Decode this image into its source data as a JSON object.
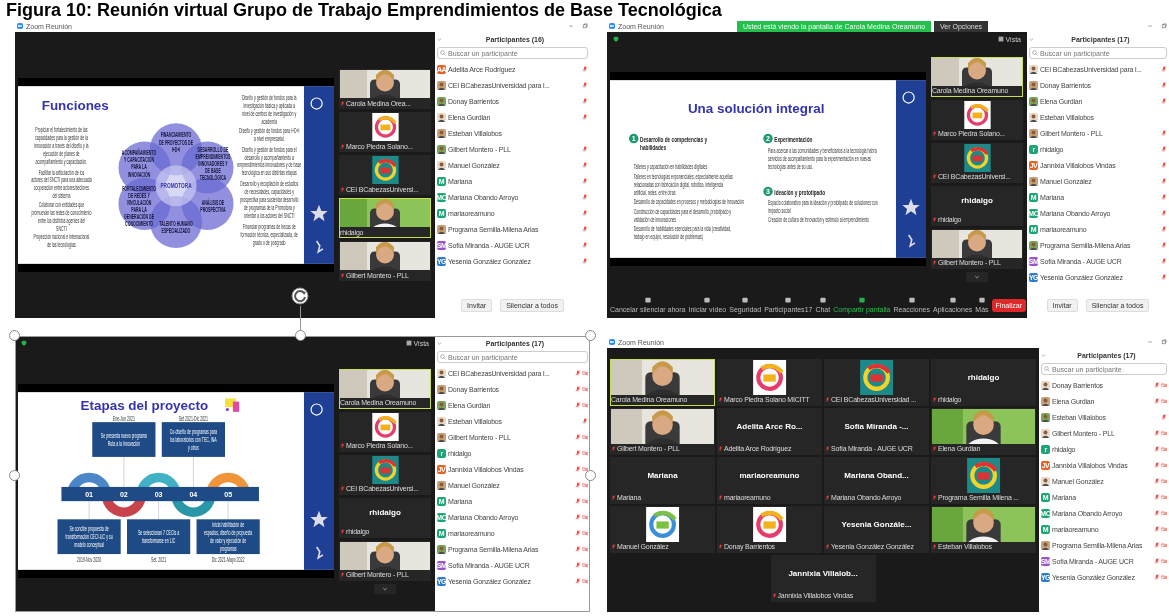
{
  "caption": "Figura 10: Reunión virtual Grupo de Trabajo Emprendimientos de Base Tecnológica",
  "windows": [
    {
      "title": "Zoom Reunión",
      "selected": false,
      "slide": {
        "kind": "flower",
        "title": "Funciones",
        "center": "PROMOTORA",
        "petals": [
          "FINANCIAMIENTO DE PROYECTOS DE I+D+i",
          "ACOMPAÑAMIENTO Y CAPACITACIÓN PARA LA INNOVACIÓN",
          "DESARROLLO DE EMPRENDIMIENTOS INNOVADORES Y DE BASE TECNOLÓGICA",
          "FORTALECIMIENTO DE REDES Y VINCULACIÓN PARA LA GENERACIÓN DE CONOCIMIENTO",
          "ANÁLISIS DE PROSPECTIVA",
          "TALENTO HUMANO ESPECIALIZADO"
        ],
        "notes": [
          {
            "bullets": [
              "Diseño y gestión de fondos para la investigación básica y aplicada a nivel de centros de investigación y academia",
              "Diseño y gestión de fondos para I+D+i a nivel empresarial."
            ]
          },
          {
            "bullets": [
              "Propiciar el fortalecimiento de las capacidades para la gestión de la innovación a través del diseño y la ejecución de planes de acompañamiento y capacitación."
            ]
          },
          {
            "bullets": [
              "Diseño y gestión de fondos para el desarrollo y acompañamiento a emprendimientos innovadores y de base tecnológica en sus distintas etapas"
            ]
          },
          {
            "bullets": [
              "Facilitar la articulación de los actores del SNCTI para una adecuada cooperación entre actores/sectores del sistema",
              "Colaborar con entidades que promuevan las redes de conocimiento entre los distintos agentes del SNCTI",
              "Proyección nacional e internacional de las tecnologías"
            ]
          },
          {
            "bullets": [
              "Desarrollo y recopilación de estudios de necesidades, capacidades y prospectiva para sustentar desarrollo de programas de la Promotora y orientar a los actores del SNCTI"
            ]
          },
          {
            "bullets": [
              "Financiar programas de becas de formación técnica, especializada, de grado o de posgrado"
            ]
          }
        ]
      },
      "thumbnails": [
        {
          "kind": "video",
          "caption": "Carola Medina Orea...",
          "muted": true,
          "selected": false
        },
        {
          "caption": "Marco Piedra Solano...",
          "muted": true,
          "selected": false
        },
        {
          "caption": "CEI BCabezasUniversi...",
          "muted": true,
          "selected": false
        },
        {
          "kind": "video",
          "caption": "rhidalgo",
          "muted": false,
          "selected": true
        },
        {
          "kind": "video",
          "caption": "Gilbert Montero - PLL",
          "muted": true,
          "selected": false
        }
      ],
      "participants": {
        "title": "Participantes (16)",
        "placeholder": "Buscar un participante",
        "buttons": [
          "Invitar",
          "Silenciar a todos"
        ],
        "items": [
          {
            "name": "Adelita Arce Rodríguez",
            "kind": "initials",
            "initials": "AA",
            "color": "#e8621d",
            "muted": true,
            "video_off": false
          },
          {
            "name": "CEI BCabezasUniversidad para l...",
            "muted": true,
            "video_off": false
          },
          {
            "name": "Donay Barrientos",
            "muted": true,
            "video_off": false
          },
          {
            "name": "Elena Gurdian",
            "muted": true,
            "video_off": false
          },
          {
            "name": "Esteban Villalobos",
            "muted": false,
            "video_off": false
          },
          {
            "name": "Gilbert Montero - PLL",
            "muted": true,
            "video_off": false
          },
          {
            "name": "Manuel González",
            "muted": true,
            "video_off": false
          },
          {
            "name": "Mariana",
            "kind": "initials",
            "initials": "M",
            "color": "#1ea672",
            "muted": true,
            "video_off": false
          },
          {
            "name": "Mariana Obando Arroyo",
            "kind": "initials",
            "initials": "MO",
            "color": "#1ea672",
            "muted": true,
            "video_off": false
          },
          {
            "name": "mariaoreamuno",
            "kind": "initials",
            "initials": "M",
            "color": "#1ea672",
            "muted": true,
            "video_off": false
          },
          {
            "name": "Programa Semilla-Milena Arias",
            "muted": true,
            "video_off": false
          },
          {
            "name": "Sofía Miranda - AUGE UCR",
            "kind": "initials",
            "initials": "SM",
            "color": "#9b4fd1",
            "muted": true,
            "video_off": false
          },
          {
            "name": "Yesenia González González",
            "kind": "initials",
            "initials": "YG",
            "color": "#2b7bd0",
            "muted": true,
            "video_off": false
          }
        ]
      }
    },
    {
      "title": "Zoom Reunión",
      "selected": false,
      "encrypted": true,
      "view_label": "Vista",
      "strip_more": true,
      "share_banner": {
        "text": "Usted está viendo la pantalla de Carola Medina Oreamuno",
        "options": "Ver Opciones"
      },
      "slide": {
        "kind": "sections",
        "title": "Una solución integral",
        "sections": [
          {
            "number": "1",
            "heading": "Desarrollo de competencias y habilidades",
            "bullets": [
              "Talleres y capacitación en habilidades digitales",
              "Talleres en tecnologías exponenciales, especialmente aquellas relacionadas con fabricación digital, robótica, inteligencia artificial, redes, entre otras",
              "Desarrollo de capacidades en procesos y metodologías de innovación",
              "Construcción de capacidades para el desarrollo, prototipado y validación de innovaciones",
              "Desarrollo de habilidades esenciales para la vida (creatividad, trabajo en equipo, resolución de problemas)"
            ]
          },
          {
            "number": "2",
            "heading": "Experimentación",
            "bullets": [
              "Para acercar a las comunidades y beneficiarios a la tecnología habrá servicios de acompañamiento para la experimentación en nuevas tecnologías antes de su uso."
            ]
          },
          {
            "number": "3",
            "heading": "Ideación y prototipado",
            "bullets": [
              "Espacio colaborativo para la ideación y prototipado de soluciones con impacto social",
              "Creación de cultura de innovación y estímulo al emprendimiento"
            ]
          }
        ]
      },
      "thumbnails": [
        {
          "kind": "video",
          "caption": "Carola Medina Oreamuno",
          "muted": false,
          "selected": true
        },
        {
          "caption": "Marco Piedra Solano...",
          "muted": true,
          "selected": false
        },
        {
          "caption": "CEI BCabezasUniversi...",
          "muted": true,
          "selected": false
        },
        {
          "kind": "name",
          "label": "rhidalgo",
          "caption": "rhidalgo",
          "muted": true,
          "selected": false
        },
        {
          "kind": "video",
          "caption": "Gilbert Montero - PLL",
          "muted": true,
          "selected": false
        }
      ],
      "toolbar": [
        {
          "label": "Cancelar silenciar ahora",
          "highlighted": false
        },
        {
          "label": "Iniciar vídeo",
          "highlighted": false
        },
        {
          "label": "Seguridad",
          "highlighted": false
        },
        {
          "label": "Participantes",
          "badge": "17",
          "highlighted": false
        },
        {
          "label": "Chat",
          "highlighted": false
        },
        {
          "label": "Compartir pantalla",
          "highlighted": true
        },
        {
          "label": "Reacciones",
          "highlighted": false
        },
        {
          "label": "Aplicaciones",
          "highlighted": false
        },
        {
          "label": "Más",
          "highlighted": false
        }
      ],
      "end_button": "Finalizar",
      "participants": {
        "title": "Participantes (17)",
        "placeholder": "Buscar un participante",
        "buttons": [
          "Invitar",
          "Silenciar a todos"
        ],
        "items": [
          {
            "name": "CEI BCabezasUniversidad para l...",
            "muted": true,
            "video_off": false
          },
          {
            "name": "Donay Barrientos",
            "muted": true,
            "video_off": false
          },
          {
            "name": "Elena Gurdian",
            "muted": true,
            "video_off": false
          },
          {
            "name": "Esteban Villalobos",
            "muted": false,
            "video_off": false
          },
          {
            "name": "Gilbert Montero - PLL",
            "muted": true,
            "video_off": false
          },
          {
            "name": "rhidalgo",
            "kind": "initials",
            "initials": "r",
            "color": "#1ea672",
            "muted": true,
            "video_off": false
          },
          {
            "name": "Jannixia Villalobos Vindas",
            "kind": "initials",
            "initials": "JV",
            "color": "#e8621d",
            "muted": true,
            "video_off": false
          },
          {
            "name": "Manuel González",
            "muted": true,
            "video_off": false
          },
          {
            "name": "Mariana",
            "kind": "initials",
            "initials": "M",
            "color": "#1ea672",
            "muted": true,
            "video_off": false
          },
          {
            "name": "Mariana Obando Arroyo",
            "kind": "initials",
            "initials": "MO",
            "color": "#1ea672",
            "muted": true,
            "video_off": false
          },
          {
            "name": "mariaoreamuno",
            "kind": "initials",
            "initials": "M",
            "color": "#1ea672",
            "muted": true,
            "video_off": false
          },
          {
            "name": "Programa Semilla-Milena Arias",
            "muted": true,
            "video_off": false
          },
          {
            "name": "Sofía Miranda - AUGE UCR",
            "kind": "initials",
            "initials": "SM",
            "color": "#9b4fd1",
            "muted": true,
            "video_off": false
          },
          {
            "name": "Yesenia González González",
            "kind": "initials",
            "initials": "YG",
            "color": "#2b7bd0",
            "muted": true,
            "video_off": false
          }
        ]
      }
    },
    {
      "selected": true,
      "encrypted": true,
      "view_label": "Vista",
      "strip_more": true,
      "slide": {
        "kind": "road",
        "title": "Etapas del proyecto",
        "stages": [
          {
            "number": "01",
            "date": "2019-Nov 2020",
            "text": "Se concibe propuesta de transformación CECI-LIC y su modelo conceptual",
            "color": "#4a86c8"
          },
          {
            "number": "02",
            "date": "Ene-Jun 2021",
            "text": "Se presenta nuevo programa Ruta a la Innovación",
            "color": "#c9444a"
          },
          {
            "number": "03",
            "date": "Set. 2021",
            "text": "Se seleccionan 7 CECIs a transformarse en LIC",
            "color": "#41b2c6"
          },
          {
            "number": "04",
            "date": "Set 2021-Dic 2021",
            "text": "Co-diseño de programas para los laboratorios con TEC, INA y otros",
            "color": "#2a97a8"
          },
          {
            "number": "05",
            "date": "Dic 2021-Mayo 2022",
            "text": "Inicia habilitación de espacios, diseño de propuesta de valor y ejecución de programas",
            "color": "#f0953a"
          }
        ]
      },
      "thumbnails": [
        {
          "kind": "video",
          "caption": "Carola Medina Oreamuno",
          "muted": false,
          "selected": true
        },
        {
          "caption": "Marco Piedra Solano...",
          "muted": true,
          "selected": false
        },
        {
          "caption": "CEI BCabezasUniversi...",
          "muted": true,
          "selected": false
        },
        {
          "kind": "name",
          "label": "rhidalgo",
          "caption": "rhidalgo",
          "muted": true,
          "selected": false
        },
        {
          "kind": "video",
          "caption": "Gilbert Montero - PLL",
          "muted": true,
          "selected": false
        }
      ],
      "participants": {
        "title": "Participantes (17)",
        "placeholder": "Buscar un participante",
        "items": [
          {
            "name": "CEI BCabezasUniversidad para l...",
            "muted": true,
            "video_off": true
          },
          {
            "name": "Donay Barrientos",
            "muted": true,
            "video_off": true
          },
          {
            "name": "Elena Gurdian",
            "muted": true,
            "video_off": true
          },
          {
            "name": "Esteban Villalobos",
            "muted": true,
            "video_off": false
          },
          {
            "name": "Gilbert Montero - PLL",
            "muted": true,
            "video_off": true
          },
          {
            "name": "rhidalgo",
            "kind": "initials",
            "initials": "r",
            "color": "#1ea672",
            "muted": true,
            "video_off": true
          },
          {
            "name": "Jannixia Villalobos Vindas",
            "kind": "initials",
            "initials": "JV",
            "color": "#e8621d",
            "muted": true,
            "video_off": true
          },
          {
            "name": "Manuel González",
            "muted": true,
            "video_off": true
          },
          {
            "name": "Mariana",
            "kind": "initials",
            "initials": "M",
            "color": "#1ea672",
            "muted": true,
            "video_off": true
          },
          {
            "name": "Mariana Obando Arroyo",
            "kind": "initials",
            "initials": "MO",
            "color": "#1ea672",
            "muted": true,
            "video_off": true
          },
          {
            "name": "mariaoreamuno",
            "kind": "initials",
            "initials": "M",
            "color": "#1ea672",
            "muted": true,
            "video_off": true
          },
          {
            "name": "Programa Semilla-Milena Arias",
            "muted": true,
            "video_off": true
          },
          {
            "name": "Sofía Miranda - AUGE UCR",
            "kind": "initials",
            "initials": "SM",
            "color": "#9b4fd1",
            "muted": true,
            "video_off": true
          },
          {
            "name": "Yesenia González González",
            "kind": "initials",
            "initials": "YG",
            "color": "#2b7bd0",
            "muted": true,
            "video_off": true
          }
        ]
      }
    },
    {
      "title": "Zoom Reunión",
      "selected": false,
      "gallery": [
        {
          "kind": "video",
          "caption": "Carola Medina Oreamuno",
          "muted": false,
          "selected": true
        },
        {
          "caption": "Marco Piedra Solano MICITT",
          "muted": true,
          "selected": false
        },
        {
          "caption": "CEI BCabezasUniversidad ...",
          "muted": true,
          "selected": false
        },
        {
          "kind": "name",
          "label": "rhidalgo",
          "caption": "rhidalgo",
          "muted": true,
          "selected": false
        },
        {
          "kind": "video",
          "caption": "Gilbert Montero - PLL",
          "muted": true,
          "selected": false
        },
        {
          "kind": "name",
          "label": "Adelita Arce Ro...",
          "caption": "Adelita Arce Rodríguez",
          "muted": true,
          "selected": false
        },
        {
          "kind": "name",
          "label": "Sofía Miranda -...",
          "caption": "Sofía Miranda - AUGE UCR",
          "muted": true,
          "selected": false
        },
        {
          "kind": "video",
          "caption": "Elena Gurdian",
          "muted": true,
          "selected": false
        },
        {
          "kind": "name",
          "label": "Mariana",
          "caption": "Mariana",
          "muted": true,
          "selected": false
        },
        {
          "kind": "name",
          "label": "mariaoreamuno",
          "caption": "mariaoreamuno",
          "muted": true,
          "selected": false
        },
        {
          "kind": "name",
          "label": "Mariana Oband...",
          "caption": "Mariana Obando Arroyo",
          "muted": true,
          "selected": false
        },
        {
          "caption": "Programa Semilla Milena ...",
          "muted": true,
          "selected": false
        },
        {
          "caption": "Manuel González",
          "muted": true,
          "selected": false
        },
        {
          "caption": "Donay Barrientos",
          "muted": true,
          "selected": false
        },
        {
          "kind": "name",
          "label": "Yesenia Gonzále...",
          "caption": "Yesenia González González",
          "muted": true,
          "selected": false
        },
        {
          "kind": "video",
          "caption": "Esteban Villalobos",
          "muted": true,
          "selected": false
        },
        {
          "kind": "name",
          "label": "Jannixia Villalob...",
          "caption": "Jannixia Villalobos Vindas",
          "muted": true,
          "selected": false
        }
      ],
      "participants": {
        "title": "Participantes (17)",
        "placeholder": "Buscar un participante",
        "items": [
          {
            "name": "Donay Barrientos",
            "muted": true,
            "video_off": true
          },
          {
            "name": "Elena Gurdian",
            "muted": true,
            "video_off": true
          },
          {
            "name": "Esteban Villalobos",
            "muted": true,
            "video_off": false
          },
          {
            "name": "Gilbert Montero - PLL",
            "muted": true,
            "video_off": true
          },
          {
            "name": "rhidalgo",
            "kind": "initials",
            "initials": "r",
            "color": "#1ea672",
            "muted": true,
            "video_off": true
          },
          {
            "name": "Jannixia Villalobos Vindas",
            "kind": "initials",
            "initials": "JV",
            "color": "#e8621d",
            "muted": true,
            "video_off": true
          },
          {
            "name": "Manuel González",
            "muted": true,
            "video_off": true
          },
          {
            "name": "Mariana",
            "kind": "initials",
            "initials": "M",
            "color": "#1ea672",
            "muted": true,
            "video_off": true
          },
          {
            "name": "Mariana Obando Arroyo",
            "kind": "initials",
            "initials": "MO",
            "color": "#1ea672",
            "muted": true,
            "video_off": true
          },
          {
            "name": "mariaoreamuno",
            "kind": "initials",
            "initials": "M",
            "color": "#1ea672",
            "muted": true,
            "video_off": true
          },
          {
            "name": "Programa Semilla-Milena Arias",
            "muted": true,
            "video_off": true
          },
          {
            "name": "Sofía Miranda - AUGE UCR",
            "kind": "initials",
            "initials": "SM",
            "color": "#9b4fd1",
            "muted": true,
            "video_off": true
          },
          {
            "name": "Yesenia González González",
            "kind": "initials",
            "initials": "YG",
            "color": "#2b7bd0",
            "muted": true,
            "video_off": true
          }
        ]
      }
    }
  ]
}
